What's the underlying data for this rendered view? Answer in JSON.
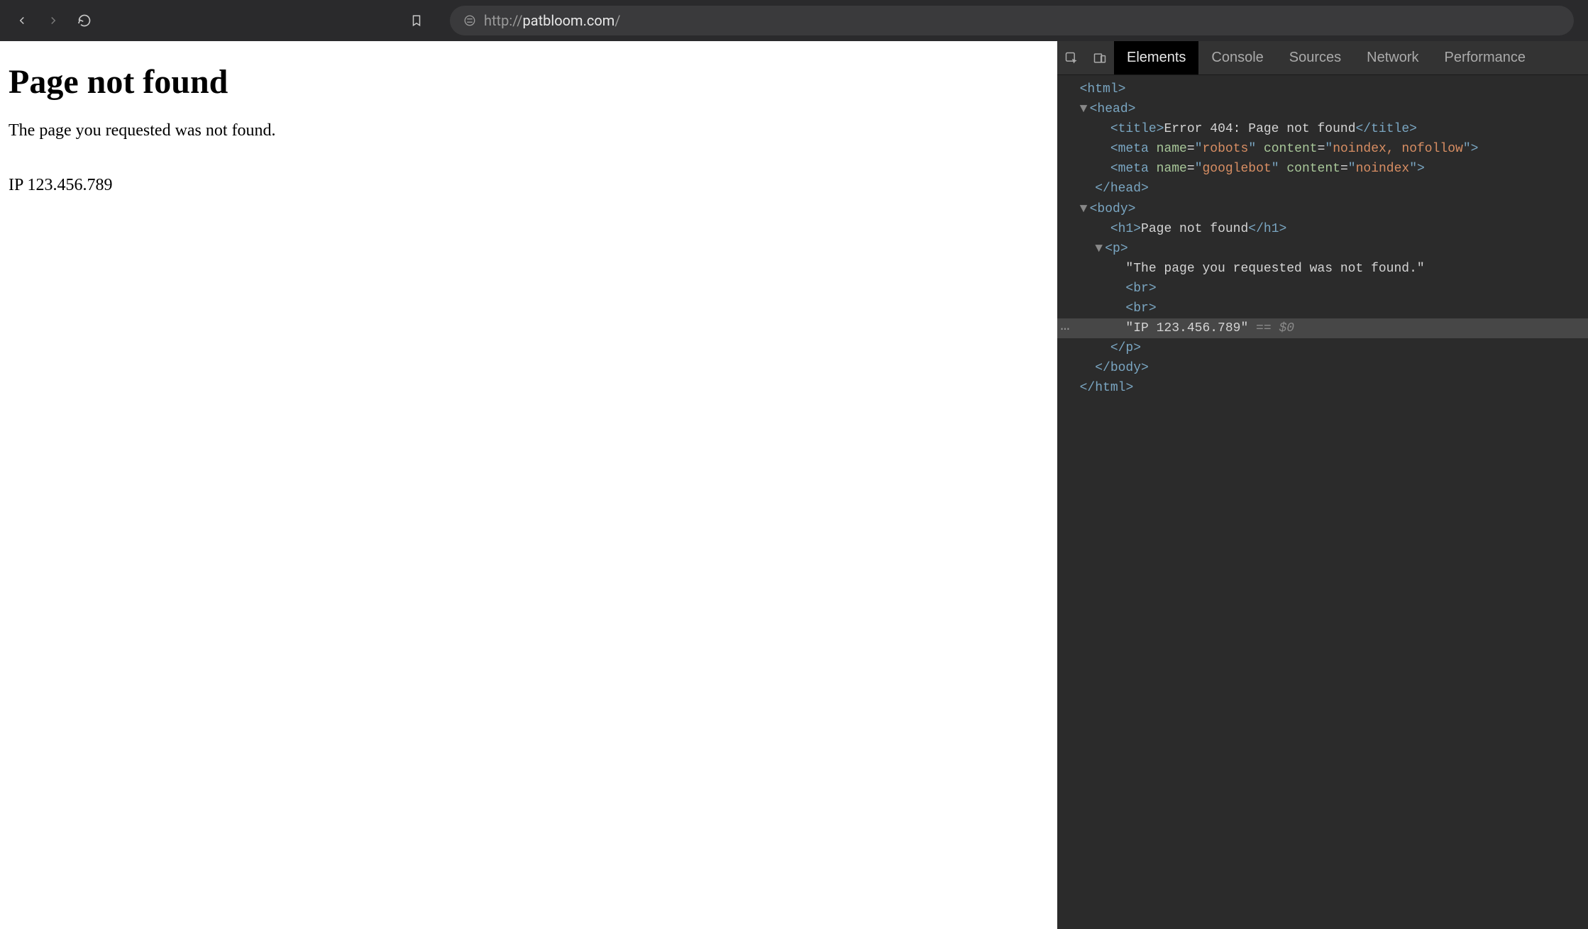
{
  "browser": {
    "url_protocol": "http://",
    "url_host": "patbloom.com",
    "url_path": "/"
  },
  "page": {
    "heading": "Page not found",
    "message": "The page you requested was not found.",
    "ip_line": "IP 123.456.789"
  },
  "devtools": {
    "tabs": {
      "elements": "Elements",
      "console": "Console",
      "sources": "Sources",
      "network": "Network",
      "performance": "Performance"
    },
    "dom": {
      "html_open": "<html>",
      "head_open": "<head>",
      "title_open": "<title>",
      "title_text": "Error 404: Page not found",
      "title_close": "</title>",
      "meta1_open": "<meta ",
      "meta1_name_attr": "name",
      "meta1_name_val": "robots",
      "meta1_content_attr": "content",
      "meta1_content_val": "noindex, nofollow",
      "meta2_name_val": "googlebot",
      "meta2_content_val": "noindex",
      "head_close": "</head>",
      "body_open": "<body>",
      "h1_open": "<h1>",
      "h1_text": "Page not found",
      "h1_close": "</h1>",
      "p_open": "<p>",
      "p_text1": "\"The page you requested was not found.\"",
      "br": "<br>",
      "p_text2": "\"IP 123.456.789\"",
      "eq_dollar": " == $0",
      "p_close": "</p>",
      "body_close": "</body>",
      "html_close": "</html>"
    }
  }
}
